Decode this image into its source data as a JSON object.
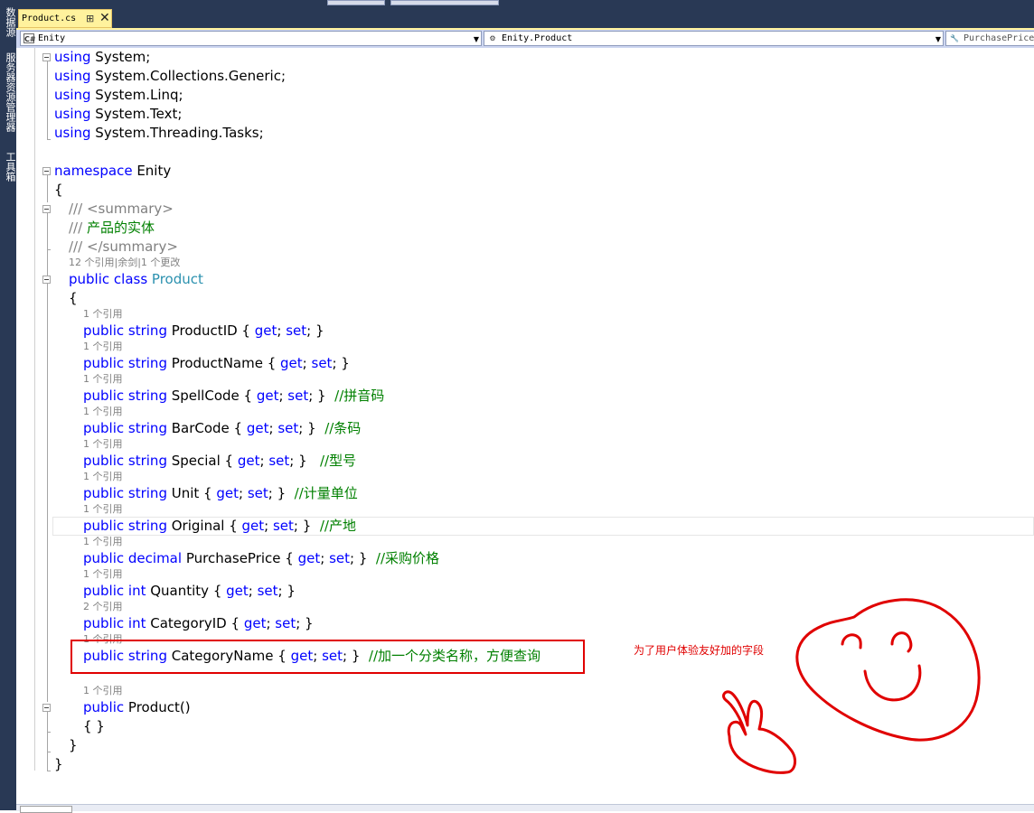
{
  "sidebar": {
    "tabs": [
      "数据源",
      "服务器资源管理器",
      "工具箱"
    ]
  },
  "tab": {
    "title": "Product.cs",
    "pin": "⊞",
    "close": "✕"
  },
  "nav": {
    "project": "Enity",
    "project_icon": "C#",
    "type": "Enity.Product",
    "member": "PurchasePrice"
  },
  "code": {
    "l1a": "using",
    "l1b": " System;",
    "l2a": "using",
    "l2b": " System.Collections.Generic;",
    "l3a": "using",
    "l3b": " System.Linq;",
    "l4a": "using",
    "l4b": " System.Text;",
    "l5a": "using",
    "l5b": " System.Threading.Tasks;",
    "ns_kw": "namespace",
    "ns_name": " Enity",
    "open_brace": "{",
    "close_brace": "}",
    "doc1a": "/// ",
    "doc1b": "<summary>",
    "doc2a": "/// ",
    "doc2b": "产品的实体",
    "doc3a": "/// ",
    "doc3b": "</summary>",
    "class_lens": "12 个引用|余剑|1 个更改",
    "class_kw": "public class",
    "class_name": " Product",
    "ref1": "1 个引用",
    "ref2": "2 个引用",
    "p1_kw": "public string",
    "p1_rest": " ProductID { ",
    "get": "get",
    "sc": "; ",
    "set": "set",
    "end": "; }",
    "p2_kw": "public string",
    "p2_rest": " ProductName { ",
    "p3_kw": "public string",
    "p3_rest": " SpellCode { ",
    "p3_cm": "  //拼音码",
    "p4_kw": "public string",
    "p4_rest": " BarCode { ",
    "p4_cm": "  //条码",
    "p5_kw": "public string",
    "p5_rest": " Special { ",
    "p5_cm": "   //型号",
    "p6_kw": "public string",
    "p6_rest": " Unit { ",
    "p6_cm": "  //计量单位",
    "p7_kw": "public string",
    "p7_rest": " Original { ",
    "p7_cm": "  //产地",
    "p8_kw": "public decimal",
    "p8_rest": " PurchasePrice { ",
    "p8_cm": "  //采购价格",
    "p9_kw": "public int",
    "p9_rest": " Quantity { ",
    "p10_kw": "public int",
    "p10_rest": " CategoryID { ",
    "p11_kw": "public string",
    "p11_rest": " CategoryName { ",
    "p11_cm": "  //加一个分类名称，方便查询",
    "ctor_kw": "public",
    "ctor_rest": " Product()",
    "ctor_body": "{ }"
  },
  "annotation": {
    "text": "为了用户体验友好加的字段",
    "color": "#e00000"
  },
  "colors": {
    "keyword": "#0000ff",
    "type": "#2b91af",
    "comment": "#008000",
    "xmldoc": "#808080",
    "chrome": "#293955",
    "active_tab": "#fff29d"
  }
}
